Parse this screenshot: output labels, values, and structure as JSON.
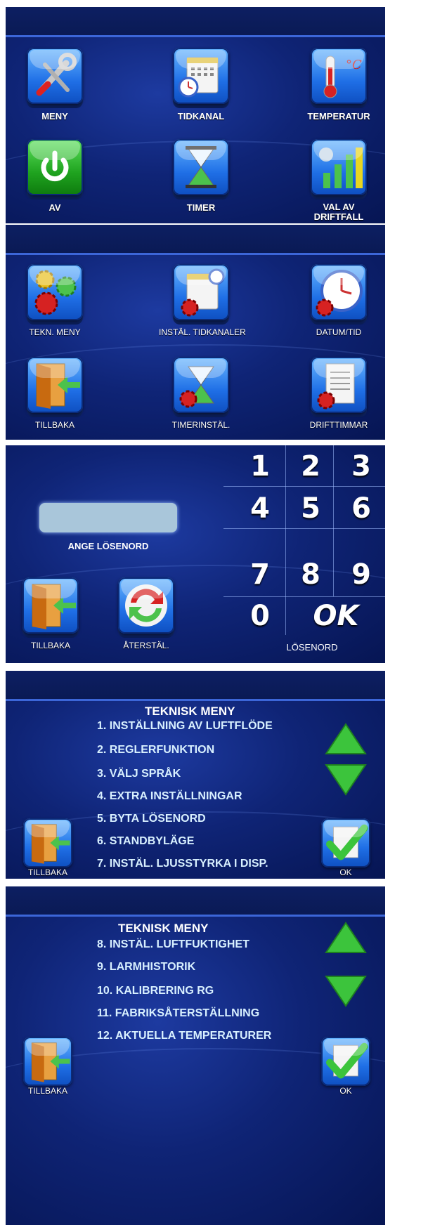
{
  "screen1": {
    "tiles": [
      {
        "label": "MENY",
        "icon": "tools-icon"
      },
      {
        "label": "TIDKANAL",
        "icon": "calendar-clock-icon"
      },
      {
        "label": "TEMPERATUR",
        "icon": "thermometer-icon"
      },
      {
        "label": "AV",
        "icon": "power-icon"
      },
      {
        "label": "TIMER",
        "icon": "hourglass-icon"
      },
      {
        "label": "VAL AV DRIFTFALL",
        "icon": "fan-bars-icon"
      }
    ]
  },
  "screen2": {
    "tiles": [
      {
        "label": "TEKN. MENY",
        "icon": "gears-icon"
      },
      {
        "label": "INSTÄL. TIDKANALER",
        "icon": "calendar-settings-icon"
      },
      {
        "label": "DATUM/TID",
        "icon": "clock-settings-icon"
      },
      {
        "label": "TILLBAKA",
        "icon": "exit-door-icon"
      },
      {
        "label": "TIMERINSTÄL.",
        "icon": "hourglass-settings-icon"
      },
      {
        "label": "DRIFTTIMMAR",
        "icon": "document-settings-icon"
      }
    ]
  },
  "screen3": {
    "password_label": "ANGE LÖSENORD",
    "password_value": "",
    "back_label": "TILLBAKA",
    "reset_label": "ÅTERSTÄL.",
    "keypad_label": "LÖSENORD",
    "keys": [
      "1",
      "2",
      "3",
      "4",
      "5",
      "6",
      "7",
      "8",
      "9",
      "0"
    ],
    "ok_key": "OK"
  },
  "screen4": {
    "title": "TEKNISK MENY",
    "items": [
      "1. INSTÄLLNING AV LUFTFLÖDE",
      "2. REGLERFUNKTION",
      "3. VÄLJ SPRÅK",
      "4. EXTRA INSTÄLLNINGAR",
      "5. BYTA LÖSENORD",
      "6. STANDBYLÄGE",
      "7. INSTÄL. LJUSSTYRKA I DISP."
    ],
    "back_label": "TILLBAKA",
    "ok_label": "OK"
  },
  "screen5": {
    "title": "TEKNISK MENY",
    "items": [
      "8.  INSTÄL. LUFTFUKTIGHET",
      "9.  LARMHISTORIK",
      "10. KALIBRERING RG",
      "11. FABRIKSÅTERSTÄLLNING",
      "12. AKTUELLA TEMPERATURER"
    ],
    "back_label": "TILLBAKA",
    "ok_label": "OK"
  },
  "colors": {
    "accent": "#3c66d8",
    "background": "#0f2476",
    "arrow_green": "#3cc43c"
  }
}
